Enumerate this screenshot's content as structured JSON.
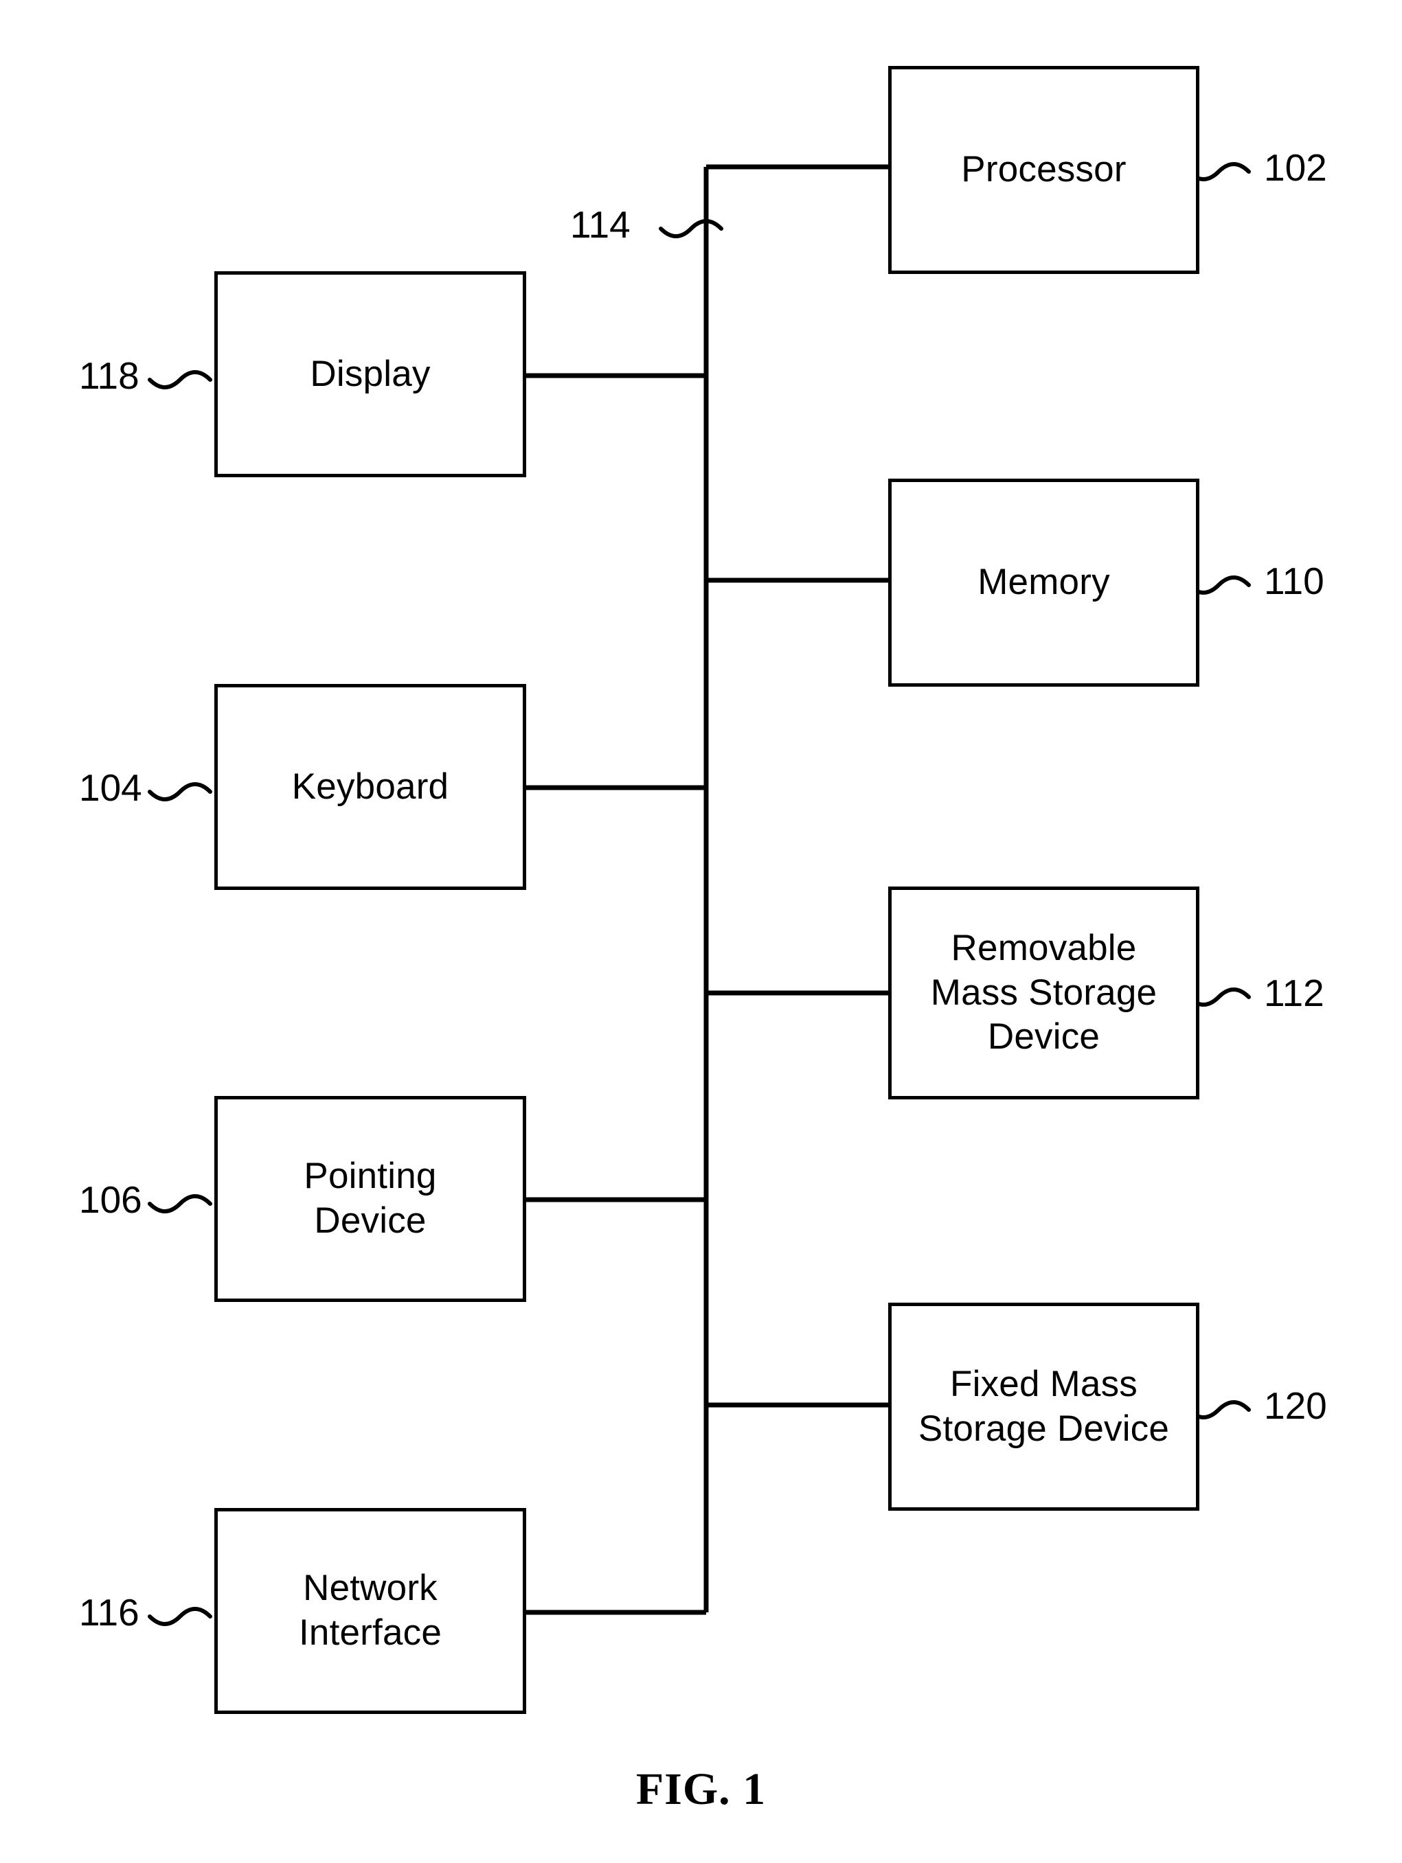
{
  "figure": {
    "caption": "FIG. 1",
    "bus_label": "114"
  },
  "blocks": {
    "processor": {
      "label": "Processor",
      "ref": "102"
    },
    "memory": {
      "label": "Memory",
      "ref": "110"
    },
    "removable_mass_storage": {
      "label": "Removable\nMass Storage\nDevice",
      "ref": "112"
    },
    "fixed_mass_storage": {
      "label": "Fixed Mass\nStorage Device",
      "ref": "120"
    },
    "display": {
      "label": "Display",
      "ref": "118"
    },
    "keyboard": {
      "label": "Keyboard",
      "ref": "104"
    },
    "pointing_device": {
      "label": "Pointing\nDevice",
      "ref": "106"
    },
    "network_interface": {
      "label": "Network\nInterface",
      "ref": "116"
    }
  },
  "colors": {
    "stroke": "#000000",
    "background": "#ffffff"
  }
}
